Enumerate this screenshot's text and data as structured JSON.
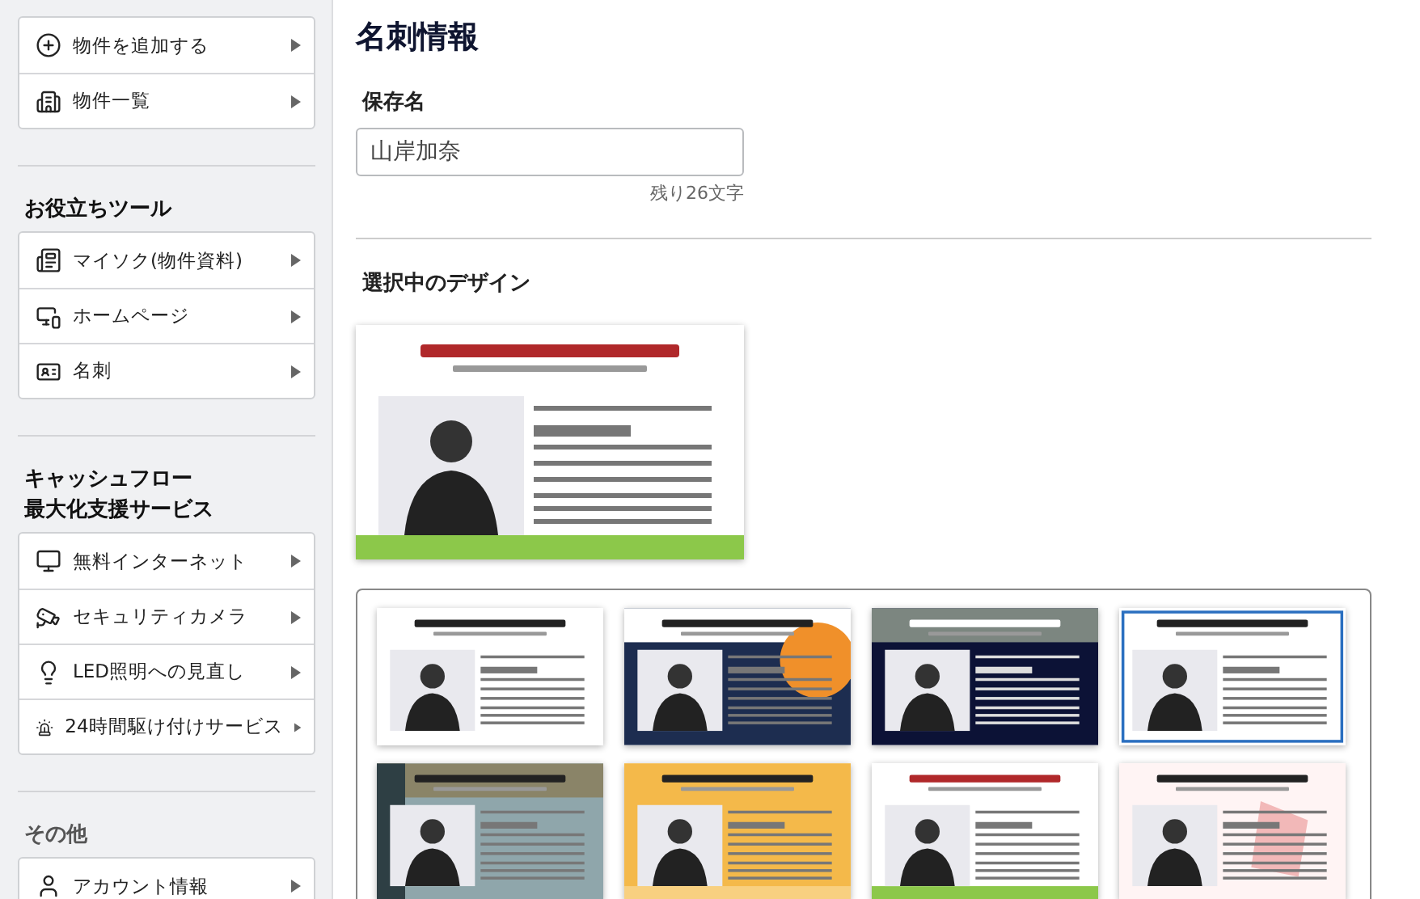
{
  "sidebar": {
    "groups": [
      {
        "items": [
          {
            "label": "物件を追加する"
          },
          {
            "label": "物件一覧"
          }
        ]
      },
      {
        "heading": [
          "お役立ちツール"
        ],
        "muted": false,
        "items": [
          {
            "label": "マイソク(物件資料)"
          },
          {
            "label": "ホームページ"
          },
          {
            "label": "名刺"
          }
        ]
      },
      {
        "heading": [
          "キャッシュフロー",
          "最大化支援サービス"
        ],
        "muted": false,
        "items": [
          {
            "label": "無料インターネット"
          },
          {
            "label": "セキュリティカメラ"
          },
          {
            "label": "LED照明への見直し"
          },
          {
            "label": "24時間駆け付けサービス"
          }
        ]
      },
      {
        "heading": [
          "その他"
        ],
        "muted": true,
        "items": [
          {
            "label": "アカウント情報"
          }
        ]
      }
    ]
  },
  "main": {
    "title": "名刺情報",
    "save_name": {
      "label": "保存名",
      "value": "山岸加奈",
      "remaining": "残り26文字"
    },
    "selected_design": {
      "label": "選択中のデザイン",
      "kind": "leaf"
    },
    "designs": [
      {
        "kind": "white"
      },
      {
        "kind": "orange"
      },
      {
        "kind": "navy"
      },
      {
        "kind": "blue"
      },
      {
        "kind": "slate"
      },
      {
        "kind": "yellow"
      },
      {
        "kind": "leaf"
      },
      {
        "kind": "pink"
      }
    ]
  }
}
